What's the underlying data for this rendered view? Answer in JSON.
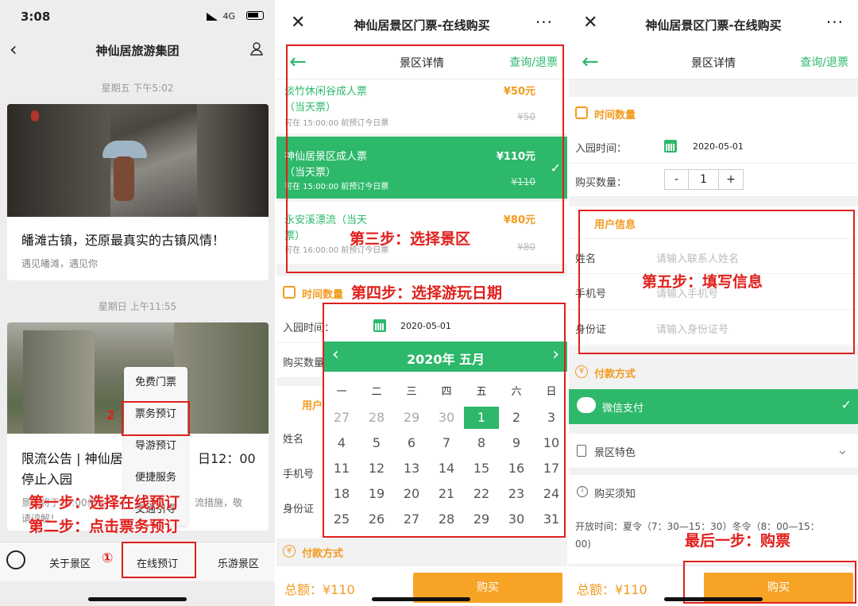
{
  "panel1": {
    "status_time": "3:08",
    "network": "4G",
    "header_title": "神仙居旅游集团",
    "timestamp1": "星期五 下午5:02",
    "article1_title": "皤滩古镇，还原最真实的古镇风情！",
    "article1_sub": "遇见皤滩，遇见你",
    "timestamp2": "星期日 上午11:55",
    "article2_line1": "限流公告 | 神仙居",
    "article2_line1_right": "日12：00",
    "article2_line2": "停止入园",
    "article2_sub1": "景区将于11:00停止",
    "article2_sub1_right": "流措施，敬",
    "article2_sub2": "请谅解！",
    "menu_items": [
      "免费门票",
      "票务预订",
      "导游预订",
      "便捷服务",
      "交通引导"
    ],
    "step2_num": "2",
    "step1_num": "①",
    "step1_text": "第一步：选择在线预订",
    "step2_text": "第二步：点击票务预订",
    "tabs": [
      "关于景区",
      "在线预订",
      "乐游景区"
    ]
  },
  "panel2": {
    "title": "神仙居景区门票-在线购买",
    "close": "✕",
    "more": "···",
    "sub_title": "景区详情",
    "query": "查询/退票",
    "tickets": [
      {
        "name": "淡竹休闲谷成人票",
        "name2": "（当天票）",
        "price": "¥50元",
        "old": "¥50",
        "note": "可在 15:00:00 前预订今日票"
      },
      {
        "name": "神仙居景区成人票",
        "name2": "（当天票）",
        "price": "¥110元",
        "old": "¥110",
        "note": "可在 15:00:00 前预订今日票"
      },
      {
        "name": "永安溪漂流（当天",
        "name2": "票）",
        "price": "¥80元",
        "old": "¥80",
        "note": "可在 16:00:00 前预订今日票"
      }
    ],
    "step3_text": "第三步：选择景区",
    "time_qty": "时间数量",
    "step4_text": "第四步：选择游玩日期",
    "entry_label": "入园时间：",
    "entry_date": "2020-05-01",
    "qty_label": "购买数量",
    "user_info": "用户",
    "name_label": "姓名",
    "phone_label": "手机号",
    "id_label": "身份证",
    "payment": "付款方式",
    "total": "总额：¥110",
    "buy": "购买",
    "calendar": {
      "month": "2020年 五月",
      "weekdays": [
        "一",
        "二",
        "三",
        "四",
        "五",
        "六",
        "日"
      ],
      "days": [
        "27",
        "28",
        "29",
        "30",
        "1",
        "2",
        "3",
        "4",
        "5",
        "6",
        "7",
        "8",
        "9",
        "10",
        "11",
        "12",
        "13",
        "14",
        "15",
        "16",
        "17",
        "18",
        "19",
        "20",
        "21",
        "22",
        "23",
        "24",
        "25",
        "26",
        "27",
        "28",
        "29",
        "30",
        "31"
      ]
    }
  },
  "panel3": {
    "title": "神仙居景区门票-在线购买",
    "sub_title": "景区详情",
    "query": "查询/退票",
    "time_qty": "时间数量",
    "entry_label": "入园时间：",
    "entry_date": "2020-05-01",
    "qty_label": "购买数量：",
    "qty_minus": "-",
    "qty_value": "1",
    "qty_plus": "+",
    "user_info": "用户信息",
    "name_label": "姓名",
    "name_ph": "请输入联系人姓名",
    "phone_label": "手机号",
    "phone_ph": "请输入手机号",
    "id_label": "身份证",
    "id_ph": "请输入身份证号",
    "step5_text": "第五步：填写信息",
    "payment": "付款方式",
    "wechat_pay": "微信支付",
    "features": "景区特色",
    "notice": "购买须知",
    "hours1": "开放时间：夏令（7：30—15：30）冬令（8：00—15：",
    "hours2": "00)",
    "last_step": "最后一步：购票",
    "total": "总额：¥110",
    "buy": "购买"
  }
}
